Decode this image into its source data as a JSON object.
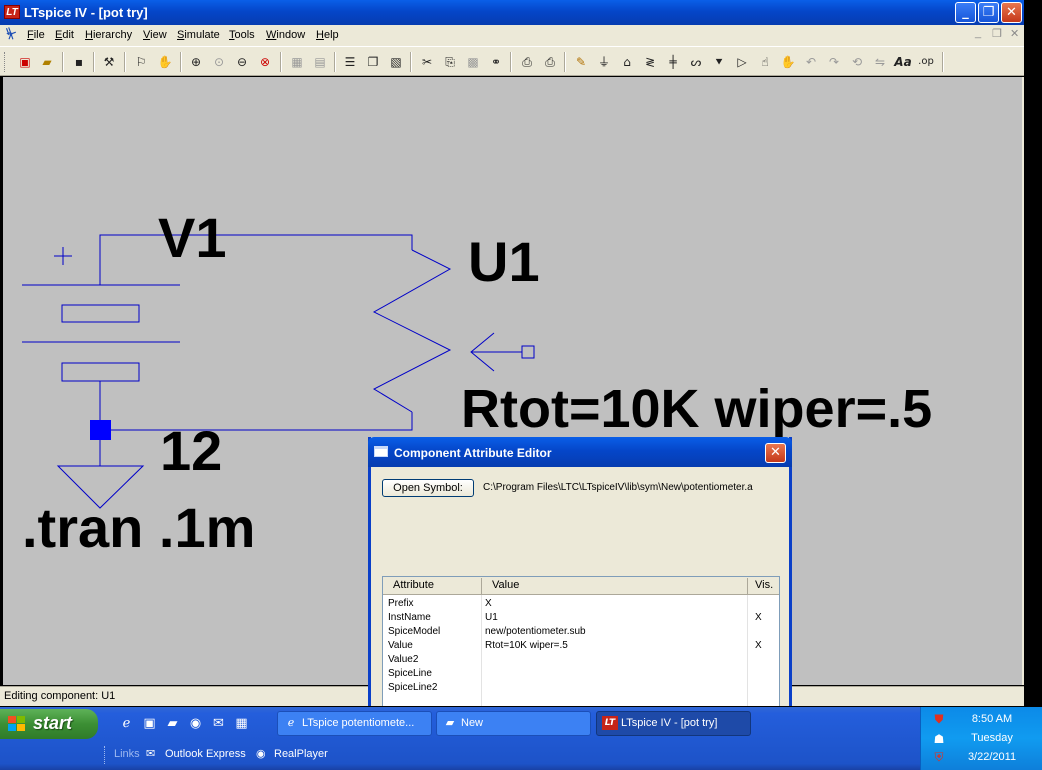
{
  "window": {
    "title": "LTspice IV - [pot try]",
    "app_icon_text": "LT"
  },
  "menu": {
    "items": [
      "File",
      "Edit",
      "Hierarchy",
      "View",
      "Simulate",
      "Tools",
      "Window",
      "Help"
    ]
  },
  "schematic": {
    "labels": {
      "source_name": "V1",
      "component_name": "U1",
      "component_value": "Rtot=10K wiper=.5",
      "source_value": "12",
      "directive": ".tran .1m",
      "plus_sign": "+"
    },
    "colors": {
      "background": "#c0c0c0",
      "wire": "#0000c8",
      "junction": "#0000ff"
    }
  },
  "status": {
    "text": "Editing component: U1"
  },
  "dialog": {
    "title": "Component Attribute Editor",
    "open_symbol_label": "Open Symbol:",
    "symbol_path": "C:\\Program Files\\LTC\\LTspiceIV\\lib\\sym\\New\\potentiometer.a",
    "columns": [
      "Attribute",
      "Value",
      "Vis."
    ],
    "rows": [
      {
        "attribute": "Prefix",
        "value": "X",
        "vis": ""
      },
      {
        "attribute": "InstName",
        "value": "U1",
        "vis": "X"
      },
      {
        "attribute": "SpiceModel",
        "value": "new/potentiometer.sub",
        "vis": ""
      },
      {
        "attribute": "Value",
        "value": "Rtot=10K wiper=.5",
        "vis": "X"
      },
      {
        "attribute": "Value2",
        "value": "",
        "vis": ""
      },
      {
        "attribute": "SpiceLine",
        "value": "",
        "vis": ""
      },
      {
        "attribute": "SpiceLine2",
        "value": "",
        "vis": ""
      }
    ]
  },
  "taskbar": {
    "start_label": "start",
    "tasks": [
      {
        "label": "LTspice potentiomete...",
        "icon": "internet-explorer-icon",
        "active": false
      },
      {
        "label": "New",
        "icon": "folder-icon",
        "active": false
      },
      {
        "label": "LTspice IV - [pot try]",
        "icon": "ltspice-icon",
        "active": true
      }
    ],
    "links_label": "Links",
    "links": [
      "Outlook Express",
      "RealPlayer"
    ],
    "clock": {
      "time": "8:50 AM",
      "day": "Tuesday",
      "date": "3/22/2011"
    }
  }
}
